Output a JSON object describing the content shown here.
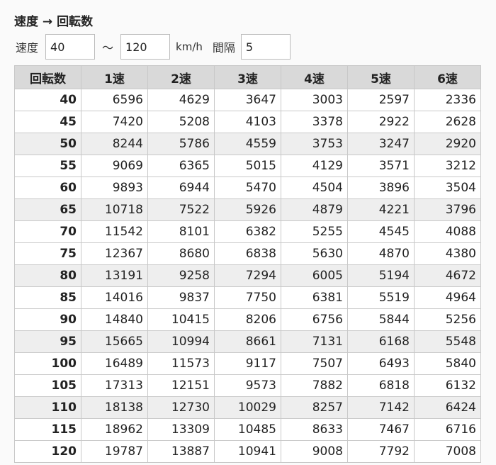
{
  "title": "速度 → 回転数",
  "controls": {
    "speed_label": "速度",
    "speed_from": "40",
    "tilde": "～",
    "speed_to": "120",
    "unit": "km/h",
    "interval_label": "間隔",
    "interval": "5"
  },
  "table": {
    "headers": [
      "回転数",
      "1速",
      "2速",
      "3速",
      "4速",
      "5速",
      "6速"
    ],
    "rows": [
      [
        "40",
        "6596",
        "4629",
        "3647",
        "3003",
        "2597",
        "2336"
      ],
      [
        "45",
        "7420",
        "5208",
        "4103",
        "3378",
        "2922",
        "2628"
      ],
      [
        "50",
        "8244",
        "5786",
        "4559",
        "3753",
        "3247",
        "2920"
      ],
      [
        "55",
        "9069",
        "6365",
        "5015",
        "4129",
        "3571",
        "3212"
      ],
      [
        "60",
        "9893",
        "6944",
        "5470",
        "4504",
        "3896",
        "3504"
      ],
      [
        "65",
        "10718",
        "7522",
        "5926",
        "4879",
        "4221",
        "3796"
      ],
      [
        "70",
        "11542",
        "8101",
        "6382",
        "5255",
        "4545",
        "4088"
      ],
      [
        "75",
        "12367",
        "8680",
        "6838",
        "5630",
        "4870",
        "4380"
      ],
      [
        "80",
        "13191",
        "9258",
        "7294",
        "6005",
        "5194",
        "4672"
      ],
      [
        "85",
        "14016",
        "9837",
        "7750",
        "6381",
        "5519",
        "4964"
      ],
      [
        "90",
        "14840",
        "10415",
        "8206",
        "6756",
        "5844",
        "5256"
      ],
      [
        "95",
        "15665",
        "10994",
        "8661",
        "7131",
        "6168",
        "5548"
      ],
      [
        "100",
        "16489",
        "11573",
        "9117",
        "7507",
        "6493",
        "5840"
      ],
      [
        "105",
        "17313",
        "12151",
        "9573",
        "7882",
        "6818",
        "6132"
      ],
      [
        "110",
        "18138",
        "12730",
        "10029",
        "8257",
        "7142",
        "6424"
      ],
      [
        "115",
        "18962",
        "13309",
        "10485",
        "8633",
        "7467",
        "6716"
      ],
      [
        "120",
        "19787",
        "13887",
        "10941",
        "9008",
        "7792",
        "7008"
      ]
    ],
    "shaded_rows": [
      2,
      5,
      8,
      11,
      14
    ]
  }
}
